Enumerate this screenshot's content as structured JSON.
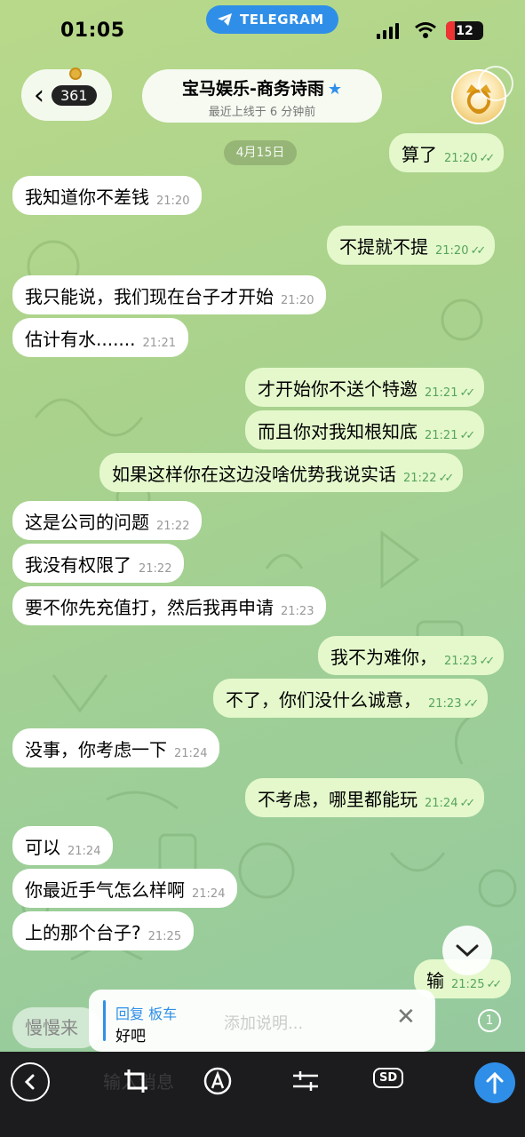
{
  "status": {
    "time": "01:05",
    "app_pill": "TELEGRAM",
    "battery": "12"
  },
  "header": {
    "unread_count": "361",
    "title": "宝马娱乐-商务诗雨",
    "subtitle": "最近上线于 6 分钟前"
  },
  "date_chip": "4月15日",
  "messages": [
    {
      "dir": "out",
      "text": "算了",
      "time": "21:20"
    },
    {
      "dir": "in",
      "text": "我知道你不差钱",
      "time": "21:20"
    },
    {
      "dir": "out",
      "text": "不提就不提",
      "time": "21:20"
    },
    {
      "dir": "in",
      "text": "我只能说，我们现在台子才开始",
      "time": "21:20"
    },
    {
      "dir": "in",
      "text": "估计有水.......",
      "time": "21:21"
    },
    {
      "dir": "out",
      "text": "才开始你不送个特邀",
      "time": "21:21"
    },
    {
      "dir": "out",
      "text": "而且你对我知根知底",
      "time": "21:21"
    },
    {
      "dir": "out",
      "text": "如果这样你在这边没啥优势我说实话",
      "time": "21:22"
    },
    {
      "dir": "in",
      "text": "这是公司的问题",
      "time": "21:22"
    },
    {
      "dir": "in",
      "text": "我没有权限了",
      "time": "21:22"
    },
    {
      "dir": "in",
      "text": "要不你先充值打，然后我再申请",
      "time": "21:23"
    },
    {
      "dir": "out",
      "text": "我不为难你，",
      "time": "21:23"
    },
    {
      "dir": "out",
      "text": "不了，你们没什么诚意，",
      "time": "21:23"
    },
    {
      "dir": "in",
      "text": "没事，你考虑一下",
      "time": "21:24"
    },
    {
      "dir": "out",
      "text": "不考虑，哪里都能玩",
      "time": "21:24"
    },
    {
      "dir": "in",
      "text": "可以",
      "time": "21:24"
    },
    {
      "dir": "in",
      "text": "你最近手气怎么样啊",
      "time": "21:24"
    },
    {
      "dir": "in",
      "text": "上的那个台子?",
      "time": "21:25"
    },
    {
      "dir": "out",
      "text": "输",
      "time": "21:25"
    }
  ],
  "compose": {
    "ghost_text": "慢慢来",
    "reply_title": "回复 板车",
    "reply_text": "好吧",
    "caption_placeholder": "添加说明...",
    "counter": "1"
  },
  "toolbar": {
    "ghost_label": "输入消息",
    "sd_label": "SD"
  }
}
